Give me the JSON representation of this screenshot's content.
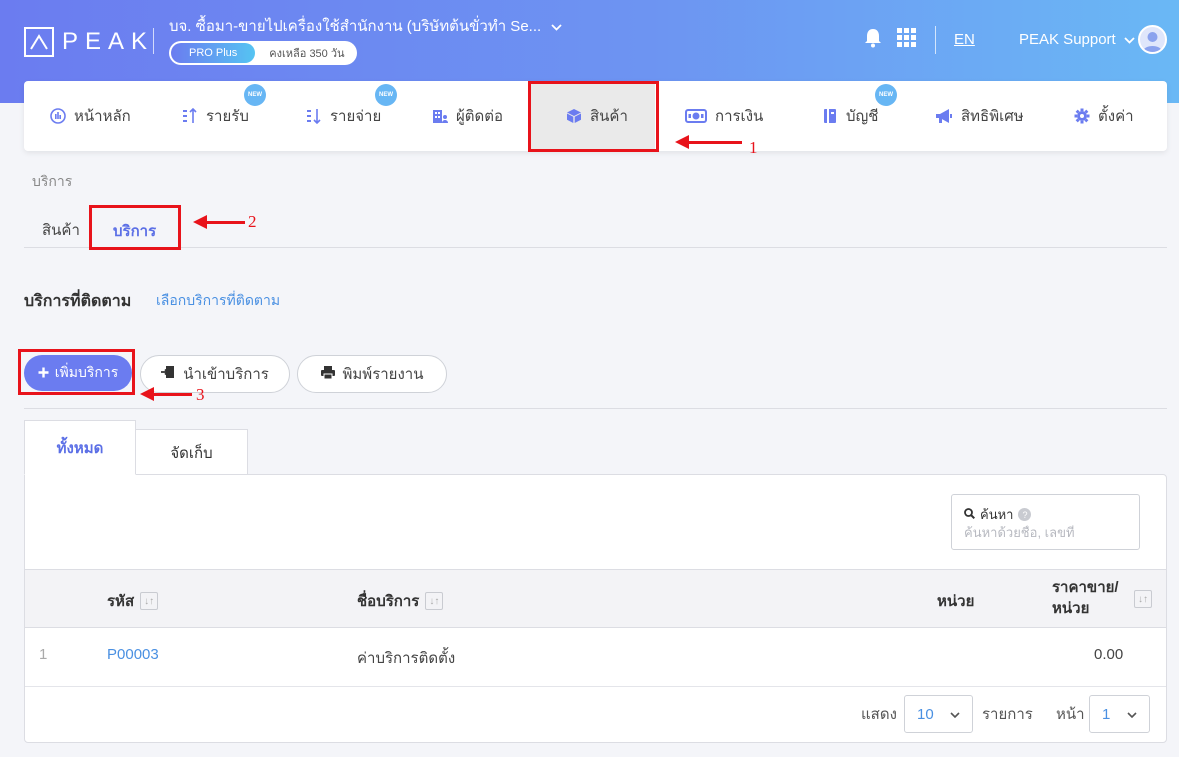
{
  "header": {
    "logo": "PEAK",
    "company": "บจ. ซื้อมา-ขายไปเครื่องใช้สำนักงาน (บริษัทต้นขั่วทำ Se...",
    "plan": "PRO Plus",
    "plan_remaining": "คงเหลือ 350 วัน",
    "language": "EN",
    "user": "PEAK Support"
  },
  "nav": {
    "items": [
      {
        "label": "หน้าหลัก",
        "icon": "dashboard-icon",
        "new": false
      },
      {
        "label": "รายรับ",
        "icon": "income-icon",
        "new": true,
        "badge": "NEW"
      },
      {
        "label": "รายจ่าย",
        "icon": "expense-icon",
        "new": true,
        "badge": "NEW"
      },
      {
        "label": "ผู้ติดต่อ",
        "icon": "contacts-icon",
        "new": false
      },
      {
        "label": "สินค้า",
        "icon": "box-icon",
        "new": false,
        "active": true
      },
      {
        "label": "การเงิน",
        "icon": "money-icon",
        "new": false
      },
      {
        "label": "บัญชี",
        "icon": "book-icon",
        "new": true,
        "badge": "NEW"
      },
      {
        "label": "สิทธิพิเศษ",
        "icon": "megaphone-icon",
        "new": false
      },
      {
        "label": "ตั้งค่า",
        "icon": "gear-icon",
        "new": false
      }
    ]
  },
  "breadcrumb": "บริการ",
  "subtabs": {
    "products": "สินค้า",
    "services": "บริการ"
  },
  "section": {
    "title": "บริการที่ติดตาม",
    "follow_link": "เลือกบริการที่ติดตาม"
  },
  "actions": {
    "add": "เพิ่มบริการ",
    "import": "นำเข้าบริการ",
    "print": "พิมพ์รายงาน"
  },
  "status_tabs": {
    "all": "ทั้งหมด",
    "archived": "จัดเก็บ"
  },
  "search": {
    "label": "ค้นหา",
    "placeholder": "ค้นหาด้วยชื่อ, เลขที่"
  },
  "table": {
    "headers": {
      "code": "รหัส",
      "name": "ชื่อบริการ",
      "unit": "หน่วย",
      "price_line1": "ราคาขาย/",
      "price_line2": "หน่วย"
    },
    "rows": [
      {
        "index": "1",
        "code": "P00003",
        "name": "ค่าบริการติดตั้ง",
        "unit": "",
        "price": "0.00"
      }
    ]
  },
  "pager": {
    "show_label": "แสดง",
    "page_size": "10",
    "items_label": "รายการ",
    "page_label": "หน้า",
    "page": "1"
  },
  "annotations": {
    "one": "1",
    "two": "2",
    "three": "3"
  },
  "colors": {
    "accent": "#6b7cf0",
    "link": "#4a90e2",
    "annotation": "#e8131b"
  }
}
